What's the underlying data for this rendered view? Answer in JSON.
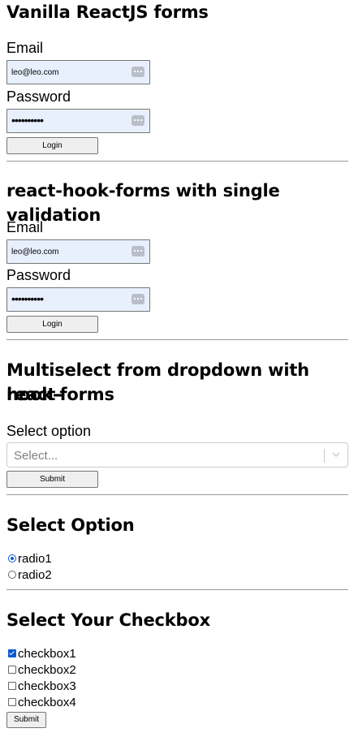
{
  "vanilla": {
    "title": "Vanilla ReactJS forms",
    "email_label": "Email",
    "email_value": "leo@leo.com",
    "password_label": "Password",
    "password_value": "••••••••••",
    "button": "Login"
  },
  "hook_single": {
    "title": "react-hook-forms with single validation",
    "email_label": "Email",
    "email_value": "leo@leo.com",
    "password_label": "Password",
    "password_value": "••••••••••",
    "button": "Login"
  },
  "multiselect": {
    "title_line1": "Multiselect from dropdown with react-",
    "title_line2": "hook-forms",
    "label": "Select option",
    "placeholder": "Select...",
    "button": "Submit"
  },
  "select_option": {
    "title": "Select Option",
    "options": [
      {
        "label": "radio1",
        "checked": true
      },
      {
        "label": "radio2",
        "checked": false
      }
    ]
  },
  "checkbox_section": {
    "title": "Select Your Checkbox",
    "options": [
      {
        "label": "checkbox1",
        "checked": true
      },
      {
        "label": "checkbox2",
        "checked": false
      },
      {
        "label": "checkbox3",
        "checked": false
      },
      {
        "label": "checkbox4",
        "checked": false
      }
    ],
    "button": "Submit"
  },
  "icons": {
    "password_manager": "password-manager-key-icon",
    "dropdown": "chevron-down-icon"
  },
  "colors": {
    "autofill_bg": "#e8f0fe",
    "accent": "#0a5bd1"
  }
}
